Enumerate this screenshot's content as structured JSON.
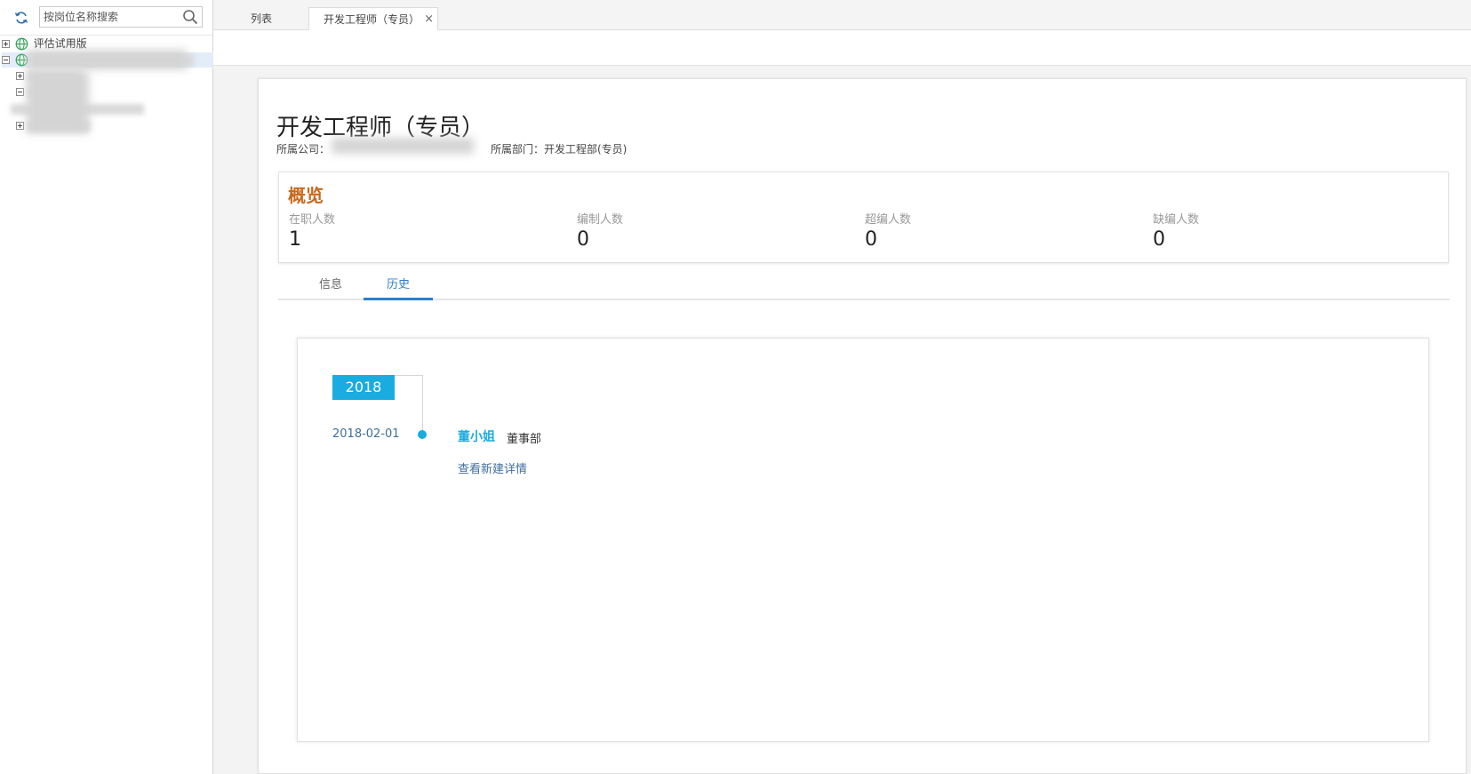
{
  "sidebar": {
    "search": {
      "placeholder": "按岗位名称搜索",
      "value": ""
    },
    "icons": {
      "refresh": "refresh-icon",
      "search": "search-icon",
      "org": "globe-icon"
    },
    "tree": [
      {
        "label": "评估试用版",
        "expanded": false
      },
      {
        "label": "",
        "expanded": true,
        "selected": true,
        "redacted": true
      }
    ]
  },
  "tabs": [
    {
      "label": "列表",
      "active": false
    },
    {
      "label": "开发工程师（专员）",
      "active": true,
      "close": "×"
    }
  ],
  "page": {
    "title": "开发工程师（专员）",
    "company_label": "所属公司：",
    "dept_label": "所属部门：开发工程部(专员)"
  },
  "overview": {
    "title": "概览",
    "stats": [
      {
        "label": "在职人数",
        "value": "1"
      },
      {
        "label": "编制人数",
        "value": "0"
      },
      {
        "label": "超编人数",
        "value": "0"
      },
      {
        "label": "缺编人数",
        "value": "0"
      }
    ]
  },
  "content_tabs": [
    {
      "label": "信息",
      "active": false
    },
    {
      "label": "历史",
      "active": true
    }
  ],
  "history": {
    "year": "2018",
    "entries": [
      {
        "date": "2018-02-01",
        "person": "董小姐",
        "dept": "董事部",
        "link": "查看新建详情"
      }
    ]
  },
  "colors": {
    "accent_blue": "#1aace0",
    "tab_active": "#2b7fd1",
    "overview_title": "#c8691c"
  }
}
